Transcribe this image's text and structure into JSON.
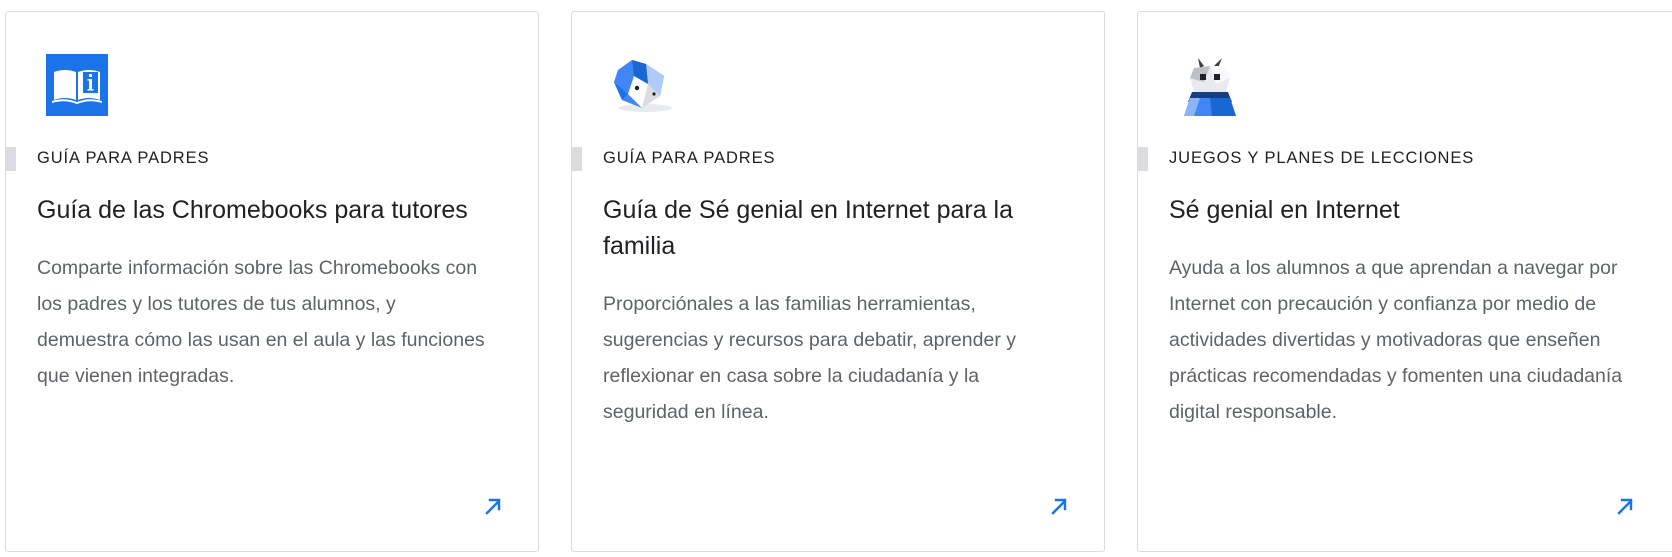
{
  "cards": [
    {
      "icon": "book-info-icon",
      "eyebrow": "GUÍA PARA PADRES",
      "title": "Guía de las Chromebooks para tutores",
      "description": "Comparte información sobre las Chromebooks con los padres y los tutores de tus alumnos, y demuestra cómo las usan en el aula y las funciones que vienen integradas.",
      "link_icon": "arrow-up-right-icon"
    },
    {
      "icon": "origami-fox-icon",
      "eyebrow": "GUÍA PARA PADRES",
      "title": "Guía de Sé genial en Internet para la familia",
      "description": "Proporciónales a las familias herramientas, sugerencias y recursos para debatir, aprender y reflexionar en casa sobre la ciudadanía y la seguridad en línea.",
      "link_icon": "arrow-up-right-icon"
    },
    {
      "icon": "origami-robot-icon",
      "eyebrow": "JUEGOS Y PLANES DE LECCIONES",
      "title": "Sé genial en Internet",
      "description": "Ayuda a los alumnos a que aprendan a navegar por Internet con precaución y confianza por medio de actividades divertidas y motivadoras que enseñen prácticas recomendadas y fomenten una ciudadanía digital responsable.",
      "link_icon": "arrow-up-right-icon"
    }
  ],
  "colors": {
    "accent": "#1a73e8",
    "title": "#202124",
    "body": "#5f6368",
    "border": "#dadce0"
  }
}
